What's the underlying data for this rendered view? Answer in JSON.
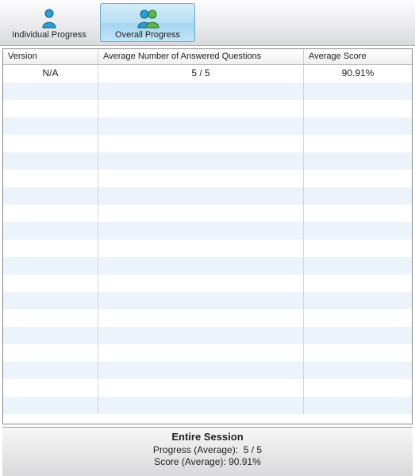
{
  "toolbar": {
    "individual_label": "Individual Progress",
    "overall_label": "Overall Progress",
    "active": "overall"
  },
  "table": {
    "columns": {
      "version": "Version",
      "avg_answered": "Average Number of Answered Questions",
      "avg_score": "Average Score"
    },
    "rows": [
      {
        "version": "N/A",
        "avg_answered": "5 / 5",
        "avg_score": "90.91%"
      },
      {
        "version": "",
        "avg_answered": "",
        "avg_score": ""
      },
      {
        "version": "",
        "avg_answered": "",
        "avg_score": ""
      },
      {
        "version": "",
        "avg_answered": "",
        "avg_score": ""
      },
      {
        "version": "",
        "avg_answered": "",
        "avg_score": ""
      },
      {
        "version": "",
        "avg_answered": "",
        "avg_score": ""
      },
      {
        "version": "",
        "avg_answered": "",
        "avg_score": ""
      },
      {
        "version": "",
        "avg_answered": "",
        "avg_score": ""
      },
      {
        "version": "",
        "avg_answered": "",
        "avg_score": ""
      },
      {
        "version": "",
        "avg_answered": "",
        "avg_score": ""
      },
      {
        "version": "",
        "avg_answered": "",
        "avg_score": ""
      },
      {
        "version": "",
        "avg_answered": "",
        "avg_score": ""
      },
      {
        "version": "",
        "avg_answered": "",
        "avg_score": ""
      },
      {
        "version": "",
        "avg_answered": "",
        "avg_score": ""
      },
      {
        "version": "",
        "avg_answered": "",
        "avg_score": ""
      },
      {
        "version": "",
        "avg_answered": "",
        "avg_score": ""
      },
      {
        "version": "",
        "avg_answered": "",
        "avg_score": ""
      },
      {
        "version": "",
        "avg_answered": "",
        "avg_score": ""
      },
      {
        "version": "",
        "avg_answered": "",
        "avg_score": ""
      },
      {
        "version": "",
        "avg_answered": "",
        "avg_score": ""
      }
    ]
  },
  "footer": {
    "title": "Entire Session",
    "progress_label": "Progress (Average):",
    "progress_value": "5 / 5",
    "score_label": "Score (Average):",
    "score_value": "90.91%"
  }
}
